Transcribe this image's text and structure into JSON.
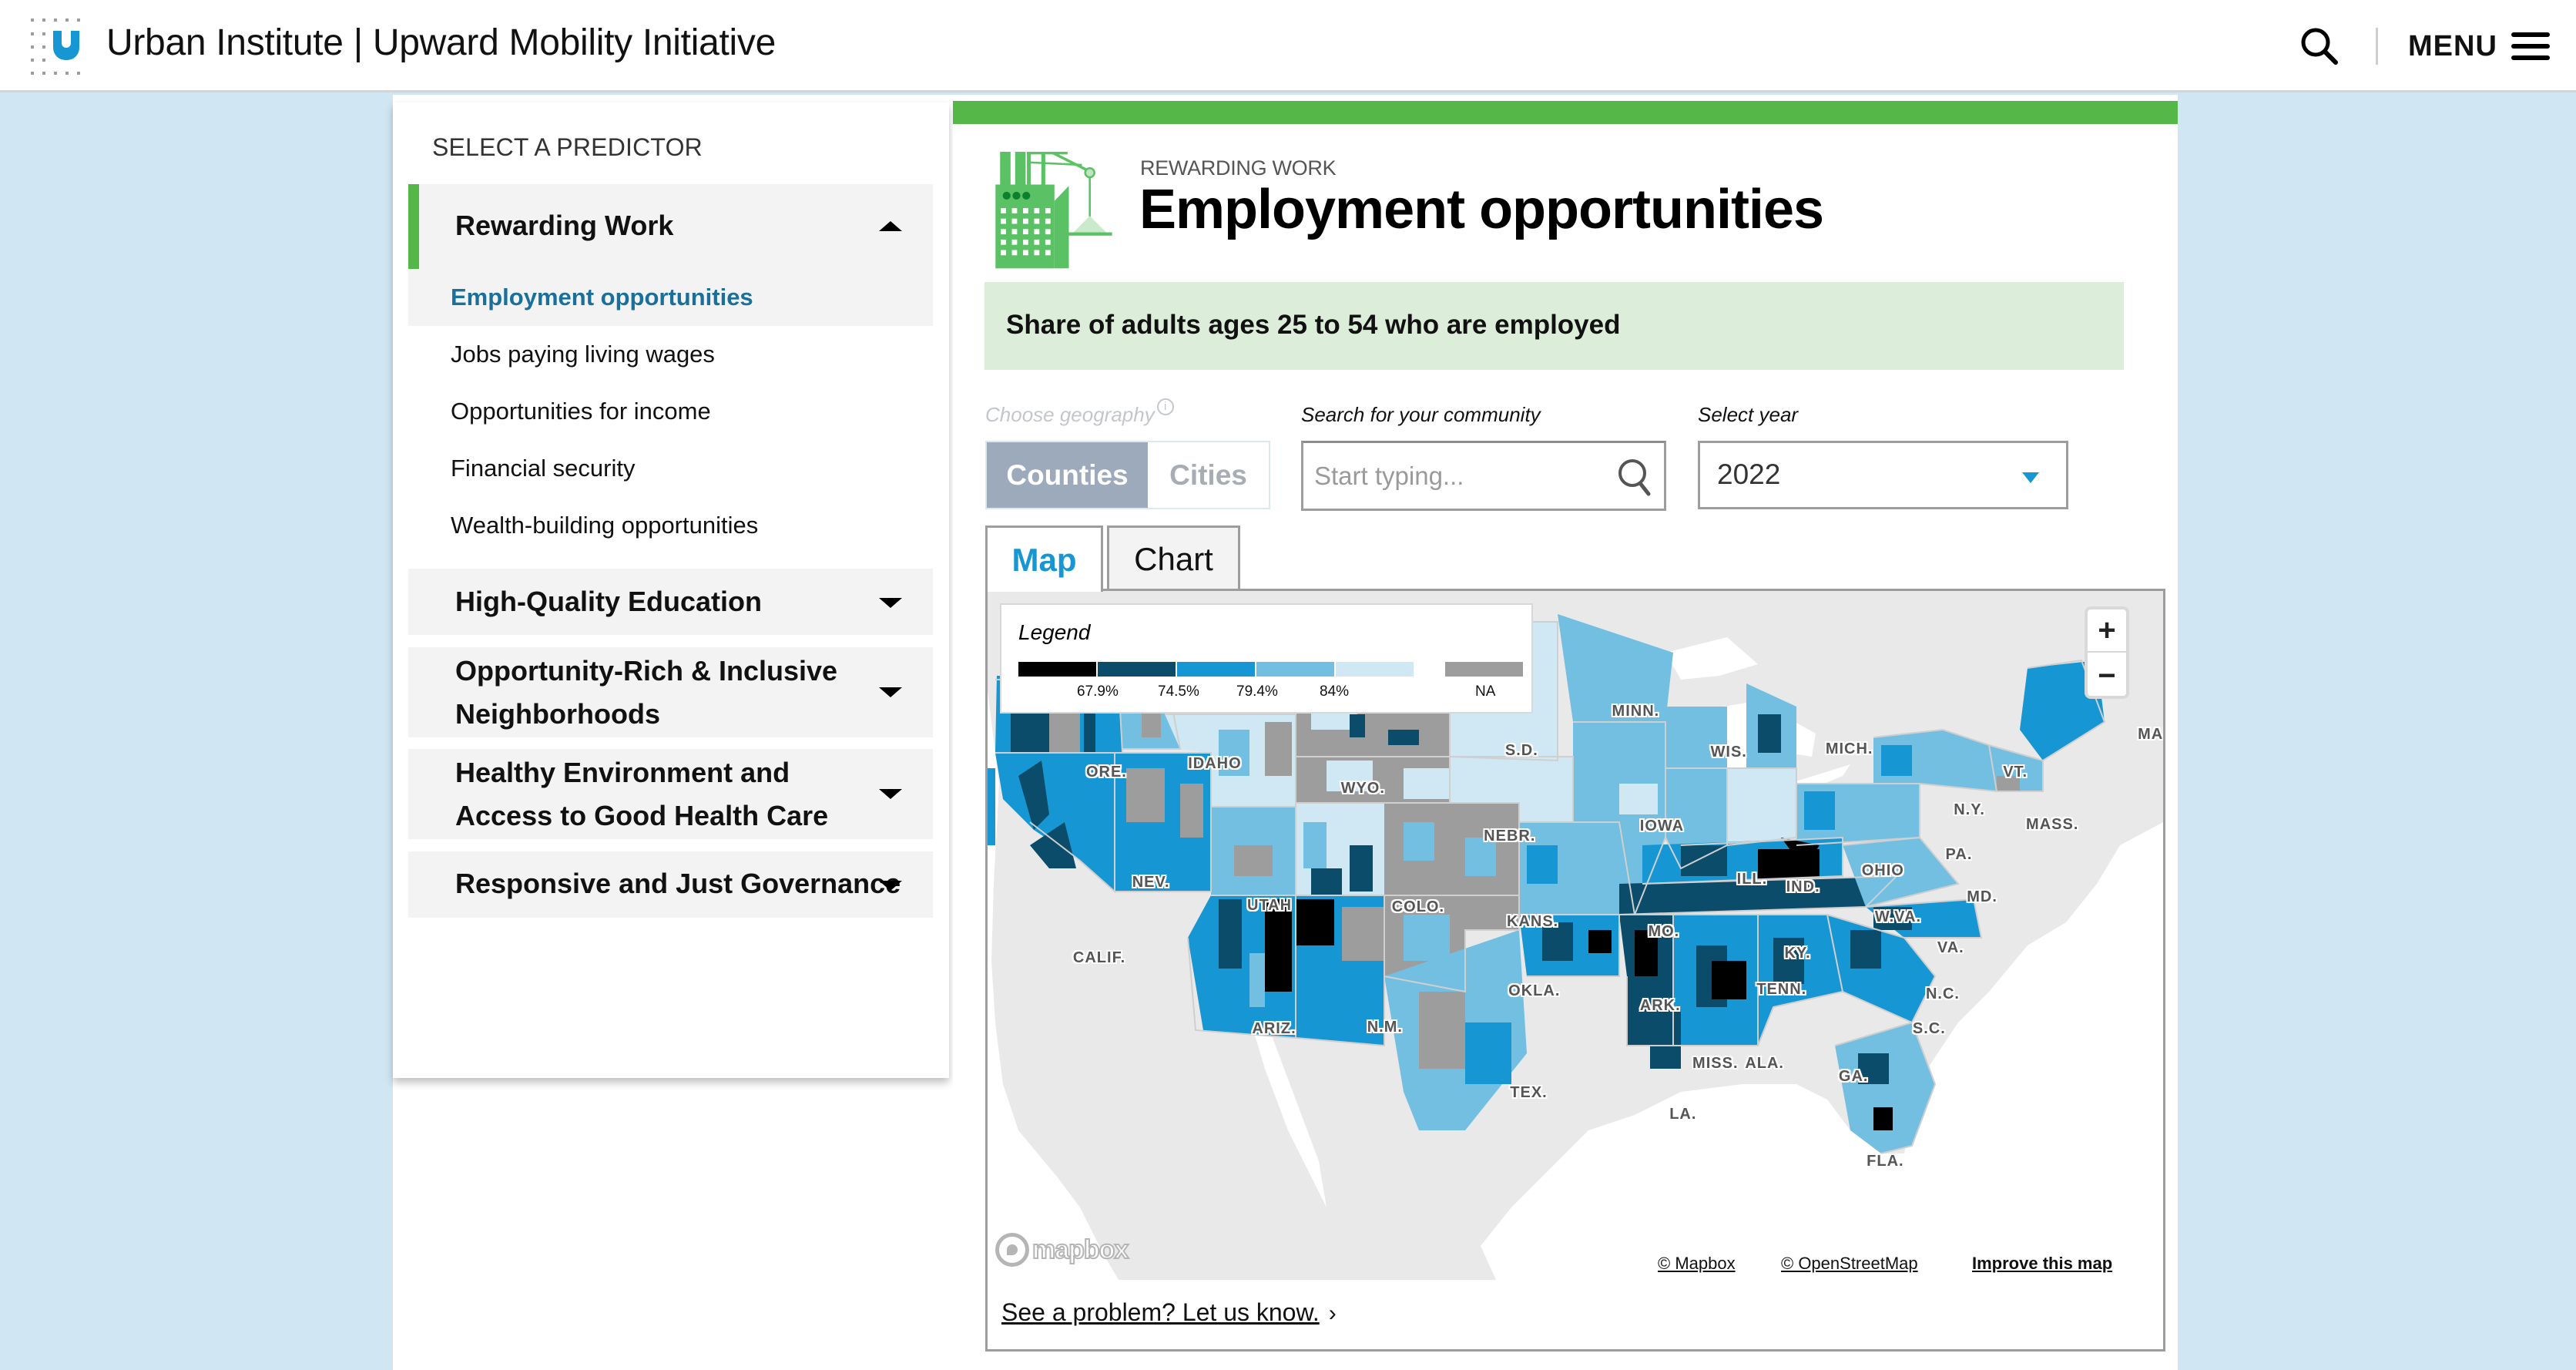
{
  "header": {
    "site_title": "Urban Institute | Upward Mobility Initiative",
    "search_icon": "search-icon",
    "menu_label": "MENU",
    "menu_icon": "hamburger-icon"
  },
  "sidebar": {
    "title": "SELECT A PREDICTOR",
    "categories": [
      {
        "label": "Rewarding Work",
        "expanded": true,
        "items": [
          {
            "label": "Employment opportunities",
            "selected": true
          },
          {
            "label": "Jobs paying living wages"
          },
          {
            "label": "Opportunities for income"
          },
          {
            "label": "Financial security"
          },
          {
            "label": "Wealth-building opportunities"
          }
        ]
      },
      {
        "label": "High-Quality Education",
        "expanded": false
      },
      {
        "label": "Opportunity-Rich & Inclusive Neighborhoods",
        "expanded": false
      },
      {
        "label": "Healthy Environment and Access to Good Health Care",
        "expanded": false
      },
      {
        "label": "Responsive and Just Governance",
        "expanded": false
      }
    ]
  },
  "main": {
    "accent_color": "#55b748",
    "kicker": "REWARDING WORK",
    "title": "Employment opportunities",
    "description": "Share of adults ages 25 to 54 who are employed",
    "controls": {
      "geography_label": "Choose geography",
      "geography_info": "i",
      "geography_options": [
        "Counties",
        "Cities"
      ],
      "geography_selected": "Counties",
      "search_label": "Search for your community",
      "search_placeholder": "Start typing...",
      "search_value": "",
      "year_label": "Select year",
      "year_value": "2022"
    },
    "tabs": [
      {
        "label": "Map",
        "active": true
      },
      {
        "label": "Chart",
        "active": false
      }
    ],
    "map": {
      "legend": {
        "title": "Legend",
        "bins": [
          {
            "color": "#000000"
          },
          {
            "color": "#0a4c6a"
          },
          {
            "color": "#1696d2"
          },
          {
            "color": "#73bfe2"
          },
          {
            "color": "#cfe8f3"
          }
        ],
        "breaks": [
          "67.9%",
          "74.5%",
          "79.4%",
          "84%"
        ],
        "na_color": "#9d9d9d",
        "na_label": "NA"
      },
      "zoom_in": "+",
      "zoom_out": "−",
      "state_labels": [
        "ORE.",
        "IDAHO",
        "WYO.",
        "S.D.",
        "MINN.",
        "WIS.",
        "MICH.",
        "MAINE",
        "VT.",
        "N.Y.",
        "MASS.",
        "NEBR.",
        "IOWA",
        "NEV.",
        "UTAH",
        "COLO.",
        "KANS.",
        "ILL.",
        "IND.",
        "OHIO",
        "PA.",
        "MD.",
        "W.VA.",
        "VA.",
        "MO.",
        "KY.",
        "CALIF.",
        "OKLA.",
        "ARK.",
        "TENN.",
        "N.C.",
        "S.C.",
        "ARIZ.",
        "N.M.",
        "MISS.",
        "ALA.",
        "GA.",
        "TEX.",
        "LA.",
        "FLA."
      ],
      "mapbox_logo": "mapbox",
      "attributions": [
        "© Mapbox",
        "© OpenStreetMap",
        "Improve this map"
      ]
    },
    "problem_link": "See a problem? Let us know.",
    "problem_chevron": "›"
  }
}
